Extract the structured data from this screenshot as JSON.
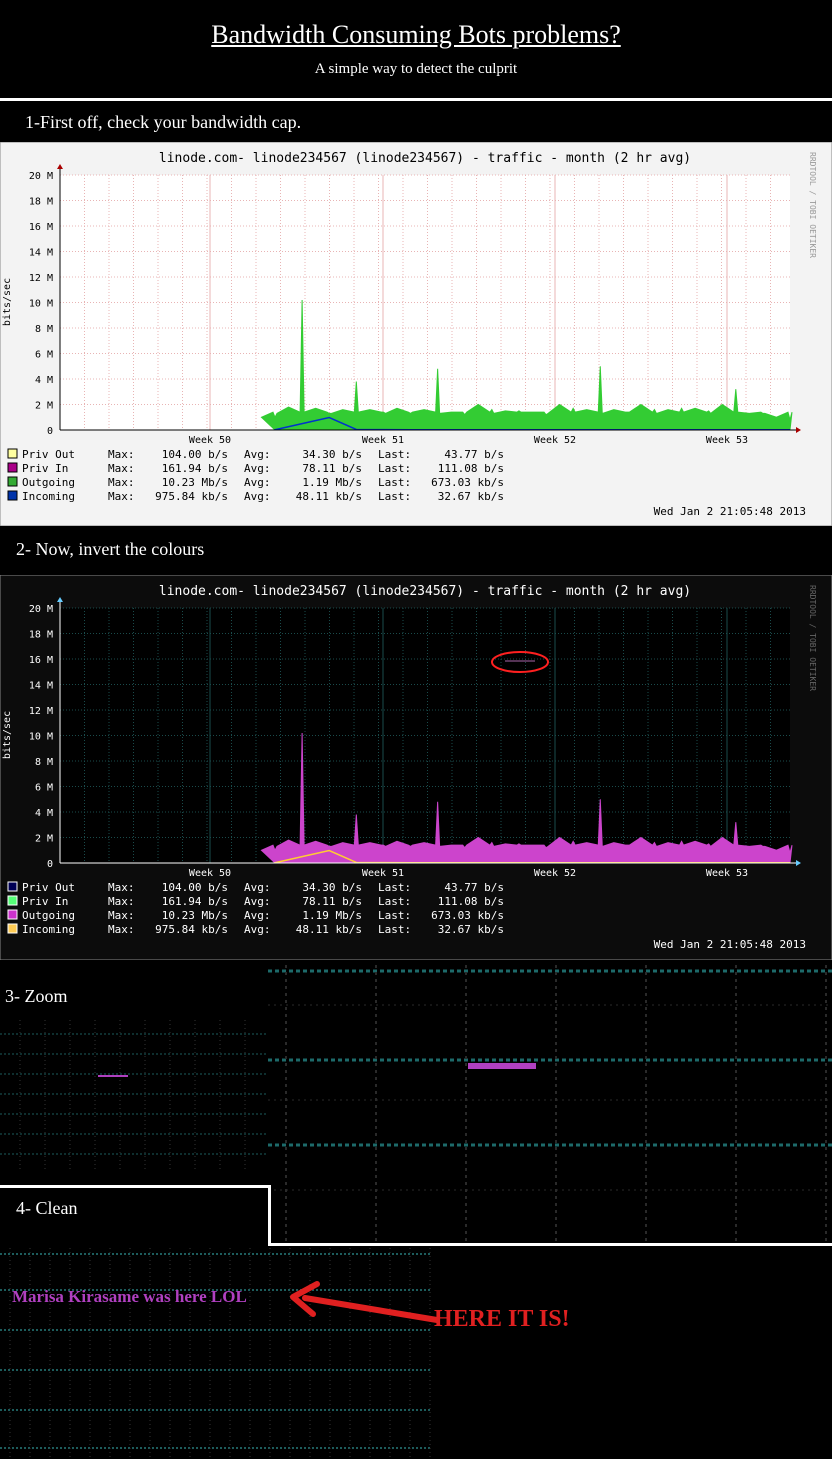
{
  "header": {
    "title": "Bandwidth Consuming Bots problems?",
    "subtitle": "A simple way to detect the culprit"
  },
  "steps": {
    "s1": "1-First off, check your bandwidth cap.",
    "s2": "2- Now, invert the colours",
    "s3": "3- Zoom",
    "s4": "4- Clean"
  },
  "chart_data": [
    {
      "type": "area",
      "title": "linode.com- linode234567 (linode234567) - traffic - month (2 hr avg)",
      "watermark": "RRDTOOL / TOBI OETIKER",
      "ylabel": "bits/sec",
      "ylim": [
        0,
        20000000
      ],
      "yticks": [
        "0",
        "2 M",
        "4 M",
        "6 M",
        "8 M",
        "10 M",
        "12 M",
        "14 M",
        "16 M",
        "18 M",
        "20 M"
      ],
      "xticks": [
        "Week 50",
        "Week 51",
        "Week 52",
        "Week 53"
      ],
      "grid": true,
      "series": [
        {
          "name": "Outgoing",
          "values": [
            1000000,
            10200000,
            1300000,
            3800000,
            1400000,
            1300000,
            4800000,
            1200000,
            1600000,
            1500000,
            1200000,
            1700000,
            5000000,
            1400000,
            1600000,
            1700000,
            1500000,
            3200000,
            1300000,
            800000
          ]
        },
        {
          "name": "Incoming",
          "values": [
            20000,
            500000,
            975840,
            40000,
            30000,
            20000,
            20000,
            20000,
            20000,
            20000,
            20000,
            20000,
            20000,
            20000,
            20000,
            20000,
            20000,
            20000,
            20000,
            20000
          ]
        }
      ],
      "legend": [
        {
          "name": "Priv Out",
          "max": "104.00  b/s",
          "avg": "34.30  b/s",
          "last": "43.77  b/s"
        },
        {
          "name": "Priv In",
          "max": "161.94  b/s",
          "avg": "78.11  b/s",
          "last": "111.08  b/s"
        },
        {
          "name": "Outgoing",
          "max": "10.23 Mb/s",
          "avg": "1.19 Mb/s",
          "last": "673.03 kb/s"
        },
        {
          "name": "Incoming",
          "max": "975.84 kb/s",
          "avg": "48.11 kb/s",
          "last": "32.67 kb/s"
        }
      ],
      "timestamp": "Wed Jan  2 21:05:48 2013"
    }
  ],
  "labels": {
    "max": "Max:",
    "avg": "Avg:",
    "last": "Last:"
  },
  "colors": {
    "light": {
      "bg": "#f3f3f3",
      "canvas": "#ffffff",
      "text": "#000000",
      "grid": "#e8b4b4",
      "area": "#33cc33",
      "incoming": "#0033cc",
      "swatches": [
        "#ffffa0",
        "#aa0088",
        "#33aa33",
        "#0033aa"
      ],
      "watermark": "#999999"
    },
    "dark": {
      "bg": "#0c0c0c",
      "canvas": "#000000",
      "text": "#ffffff",
      "grid": "#1a4b4b",
      "area": "#cc44cc",
      "incoming": "#ffcc33",
      "swatches": [
        "#000055",
        "#55ff77",
        "#cc33cc",
        "#ffcc55"
      ],
      "watermark": "#666666"
    }
  },
  "annotation": {
    "hidden_text": "Marisa Kirasame was here LOL",
    "callout": "HERE IT IS!",
    "hidden_color": "#b040c0",
    "callout_color": "#e02020"
  }
}
